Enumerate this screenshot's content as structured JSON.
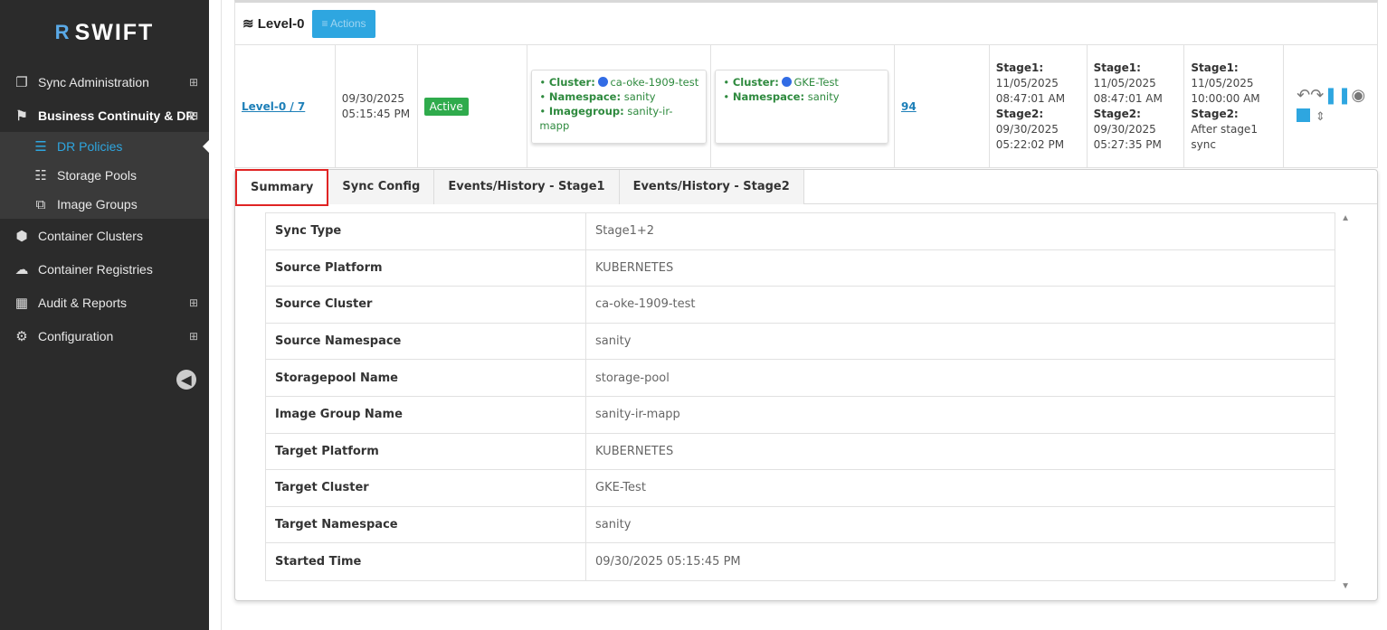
{
  "brand": {
    "name": "SWIFT",
    "mark": "R"
  },
  "sidebar": {
    "items": [
      {
        "label": "Sync Administration",
        "icon": "copy-icon",
        "plus": "⊞"
      },
      {
        "label": "Business Continuity & DR",
        "icon": "briefcase-icon",
        "plus": "⊟"
      },
      {
        "label": "DR Policies",
        "icon": "list-icon"
      },
      {
        "label": "Storage Pools",
        "icon": "database-icon"
      },
      {
        "label": "Image Groups",
        "icon": "image-icon"
      },
      {
        "label": "Container Clusters",
        "icon": "cube-icon"
      },
      {
        "label": "Container Registries",
        "icon": "cloud-icon"
      },
      {
        "label": "Audit & Reports",
        "icon": "table-icon",
        "plus": "⊞"
      },
      {
        "label": "Configuration",
        "icon": "cogs-icon",
        "plus": "⊞"
      }
    ]
  },
  "level": {
    "title": "Level-0",
    "actions_label": "Actions"
  },
  "policy_row": {
    "level_link": "Level-0 / 7",
    "created_date": "09/30/2025",
    "created_time": "05:15:45 PM",
    "status": "Active",
    "source": {
      "cluster_label": "Cluster:",
      "cluster": "ca-oke-1909-test",
      "namespace_label": "Namespace:",
      "namespace": "sanity",
      "imagegroup_label": "Imagegroup:",
      "imagegroup": "sanity-ir-mapp"
    },
    "target": {
      "cluster_label": "Cluster:",
      "cluster": "GKE-Test",
      "namespace_label": "Namespace:",
      "namespace": "sanity"
    },
    "count": "94",
    "stages": [
      {
        "s1_label": "Stage1:",
        "s1_date": "11/05/2025",
        "s1_time": "08:47:01 AM",
        "s2_label": "Stage2:",
        "s2_date": "09/30/2025",
        "s2_time": "05:22:02 PM"
      },
      {
        "s1_label": "Stage1:",
        "s1_date": "11/05/2025",
        "s1_time": "08:47:01 AM",
        "s2_label": "Stage2:",
        "s2_date": "09/30/2025",
        "s2_time": "05:27:35 PM"
      },
      {
        "s1_label": "Stage1:",
        "s1_date": "11/05/2025",
        "s1_time": "10:00:00 AM",
        "s2_label": "Stage2:",
        "s2_date": "After stage1",
        "s2_time": "sync"
      }
    ]
  },
  "tabs": [
    {
      "label": "Summary"
    },
    {
      "label": "Sync Config"
    },
    {
      "label": "Events/History - Stage1"
    },
    {
      "label": "Events/History - Stage2"
    }
  ],
  "summary": [
    {
      "key": "Sync Type",
      "value": "Stage1+2"
    },
    {
      "key": "Source Platform",
      "value": "KUBERNETES"
    },
    {
      "key": "Source Cluster",
      "value": "ca-oke-1909-test"
    },
    {
      "key": "Source Namespace",
      "value": "sanity"
    },
    {
      "key": "Storagepool Name",
      "value": "storage-pool"
    },
    {
      "key": "Image Group Name",
      "value": "sanity-ir-mapp"
    },
    {
      "key": "Target Platform",
      "value": "KUBERNETES"
    },
    {
      "key": "Target Cluster",
      "value": "GKE-Test"
    },
    {
      "key": "Target Namespace",
      "value": "sanity"
    },
    {
      "key": "Started Time",
      "value": "09/30/2025 05:15:45 PM"
    }
  ],
  "colors": {
    "accent": "#2ea6e0",
    "active_green": "#2fab4c",
    "highlight_red": "#e02424",
    "sidebar_bg": "#2b2b2b"
  }
}
